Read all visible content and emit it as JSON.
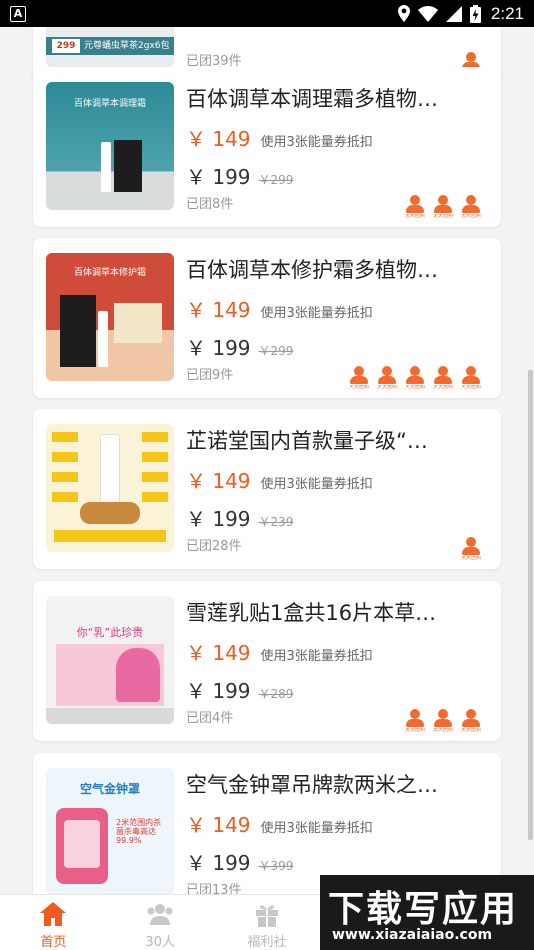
{
  "status_bar": {
    "time": "2:21"
  },
  "partial_card": {
    "joined": "已团39件",
    "thumb_text": "元尊蛹虫草茶2gx6包",
    "thumb_badge": "299"
  },
  "coupon_text": "使用3张能量券抵扣",
  "products": [
    {
      "title": "百体调草本调理霜多植物…",
      "price": "￥ 149",
      "original_price": "￥ 199",
      "strike_price": "￥299",
      "joined": "已团8件",
      "avatar_count": 3,
      "thumb_text": "百体调草本调理霜"
    },
    {
      "title": "百体调草本修护霜多植物…",
      "price": "￥ 149",
      "original_price": "￥ 199",
      "strike_price": "￥299",
      "joined": "已团9件",
      "avatar_count": 5,
      "thumb_text": "百体调草本修护霜"
    },
    {
      "title": "芷诺堂国内首款量子级“…",
      "price": "￥ 149",
      "original_price": "￥ 199",
      "strike_price": "￥239",
      "joined": "已团28件",
      "avatar_count": 1,
      "thumb_text": ""
    },
    {
      "title": "雪莲乳贴1盒共16片本草…",
      "price": "￥ 149",
      "original_price": "￥ 199",
      "strike_price": "￥289",
      "joined": "已团4件",
      "avatar_count": 3,
      "thumb_text": "你“乳”此珍贵"
    },
    {
      "title": "空气金钟罩吊牌款两米之…",
      "price": "￥ 149",
      "original_price": "￥ 199",
      "strike_price": "￥399",
      "joined": "已团13件",
      "avatar_count": 1,
      "thumb_text": "空气金钟罩"
    }
  ],
  "tabs": [
    {
      "label": "首页",
      "icon": "home-icon",
      "active": true
    },
    {
      "label": "30人",
      "icon": "people-icon",
      "active": false
    },
    {
      "label": "福利社",
      "icon": "gift-icon",
      "active": false
    },
    {
      "label": "",
      "icon": "cart-icon",
      "active": false
    },
    {
      "label": "",
      "icon": "user-icon",
      "active": false
    }
  ],
  "watermark": {
    "main": "下载写应用",
    "url": "www.xiazaiaiao.com"
  },
  "colors": {
    "accent": "#f25a1f",
    "avatar": "#f26a2e",
    "tab_inactive": "#b8b8b8"
  }
}
